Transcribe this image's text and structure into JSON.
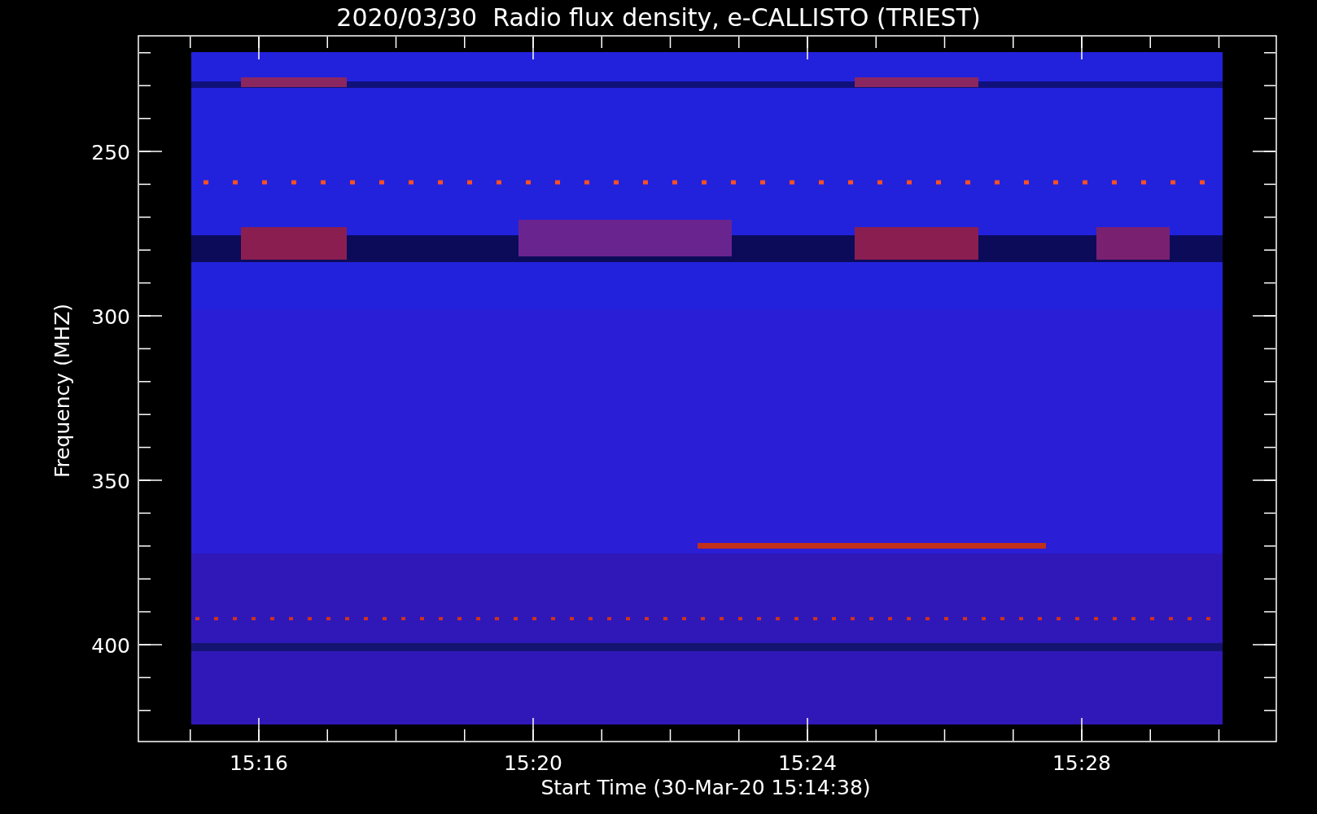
{
  "plot": {
    "title": "2020/03/30  Radio flux density, e-CALLISTO (TRIEST)",
    "ylabel": "Frequency (MHZ)",
    "xlabel": "Start Time (30-Mar-20 15:14:38)",
    "yticks": [
      "250",
      "300",
      "350",
      "400"
    ],
    "xticks": [
      "15:16",
      "15:20",
      "15:24",
      "15:28"
    ]
  }
}
